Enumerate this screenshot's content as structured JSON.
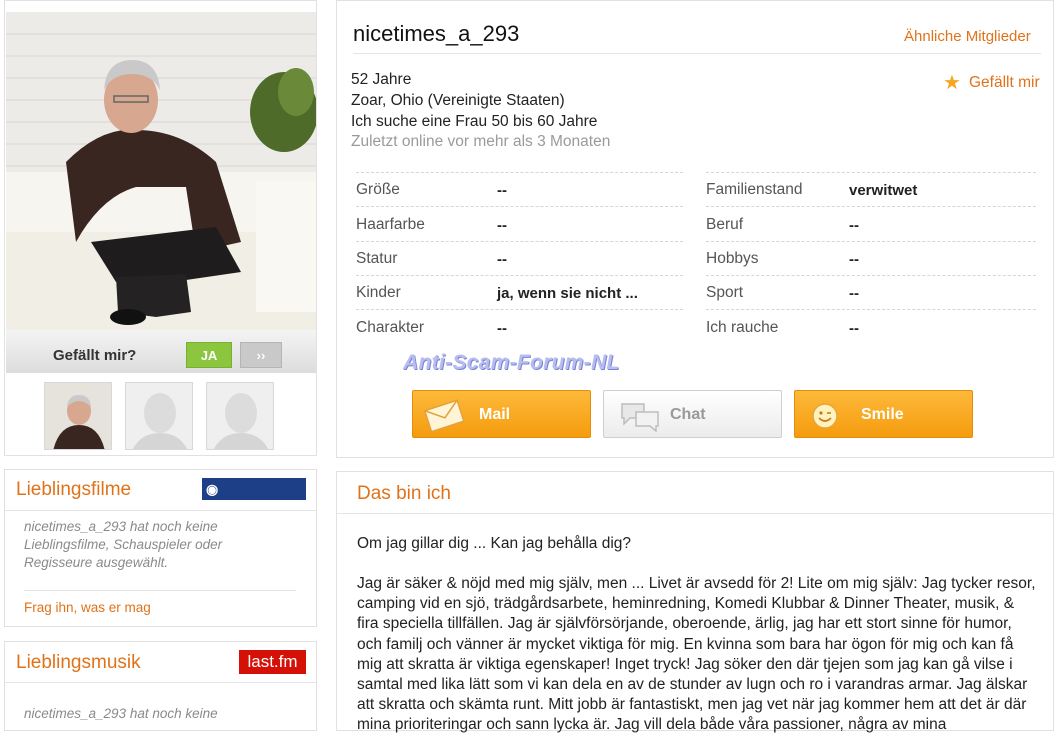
{
  "profile": {
    "like_label": "Gefällt mir?",
    "like_yes": "JA",
    "like_next": "››"
  },
  "left_boxes": {
    "movies": {
      "title": "Lieblingsfilme",
      "logo": "FILMSTARTS",
      "empty_text": "nicetimes_a_293 hat noch keine Lieblingsfilme, Schauspieler oder Regisseure ausgewählt.",
      "ask": "Frag ihn, was er mag"
    },
    "music": {
      "title": "Lieblingsmusik",
      "logo": "last.fm",
      "empty_text": "nicetimes_a_293 hat noch keine"
    }
  },
  "header": {
    "username": "nicetimes_a_293",
    "similar": "Ähnliche Mitglieder"
  },
  "info": {
    "age": "52 Jahre",
    "location": "Zoar, Ohio (Vereinigte Staaten)",
    "seeking": "Ich suche eine Frau 50 bis 60 Jahre",
    "last_online": "Zuletzt online vor mehr als 3 Monaten",
    "favorite": "Gefällt mir",
    "favorite_icon": "star-icon"
  },
  "attributes_left": [
    {
      "label": "Größe",
      "value": "--"
    },
    {
      "label": "Haarfarbe",
      "value": "--"
    },
    {
      "label": "Statur",
      "value": "--"
    },
    {
      "label": "Kinder",
      "value": "ja, wenn sie nicht ..."
    },
    {
      "label": "Charakter",
      "value": "--"
    }
  ],
  "attributes_right": [
    {
      "label": "Familienstand",
      "value": "verwitwet"
    },
    {
      "label": "Beruf",
      "value": "--"
    },
    {
      "label": "Hobbys",
      "value": "--"
    },
    {
      "label": "Sport",
      "value": "--"
    },
    {
      "label": "Ich rauche",
      "value": "--"
    }
  ],
  "watermark": "Anti-Scam-Forum-NL",
  "actions": {
    "mail": "Mail",
    "chat": "Chat",
    "smile": "Smile"
  },
  "about": {
    "title": "Das bin ich",
    "question": "Om jag gillar dig ... Kan jag behålla dig?",
    "body": "Jag är säker & nöjd med mig själv, men ... Livet är avsedd för 2! Lite om mig själv: Jag tycker resor, camping vid en sjö, trädgårdsarbete, heminredning, Komedi Klubbar & Dinner Theater, musik, & fira speciella tillfällen. Jag är självförsörjande, oberoende, ärlig, jag har ett stort sinne för humor, och familj och vänner är mycket viktiga för mig. En kvinna som bara har ögon för mig och kan få mig att skratta är viktiga egenskaper! Inget tryck! Jag söker den där tjejen som jag kan gå vilse i samtal med lika lätt som vi kan dela en av de stunder av lugn och ro i varandras armar. Jag älskar att skratta och skämta runt. Mitt jobb är fantastiskt, men jag vet när jag kommer hem att det är där mina prioriteringar och sann lycka är. Jag vill dela både våra passioner, några av mina"
  },
  "colors": {
    "accent": "#e0731a",
    "like_green": "#8cc63f",
    "button_orange": "#f59c0e"
  }
}
